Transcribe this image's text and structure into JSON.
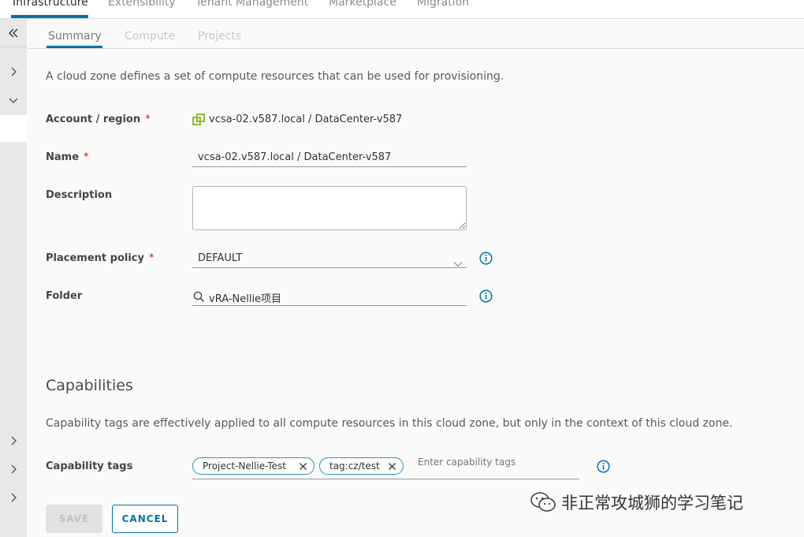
{
  "topnav": {
    "tabs": [
      "Infrastructure",
      "Extensibility",
      "Tenant Management",
      "Marketplace",
      "Migration"
    ],
    "active": "Infrastructure"
  },
  "subtabs": {
    "items": [
      "Summary",
      "Compute",
      "Projects"
    ],
    "active": "Summary"
  },
  "intro": "A cloud zone defines a set of compute resources that can be used for provisioning.",
  "form": {
    "account_region": {
      "label": "Account / region",
      "required_mark": "*",
      "value": "vcsa-02.v587.local / DataCenter-v587"
    },
    "name": {
      "label": "Name",
      "required_mark": "*",
      "value": "vcsa-02.v587.local / DataCenter-v587"
    },
    "description": {
      "label": "Description",
      "value": ""
    },
    "placement_policy": {
      "label": "Placement policy",
      "required_mark": "*",
      "value": "DEFAULT"
    },
    "folder": {
      "label": "Folder",
      "value": "vRA-Nellie项目"
    }
  },
  "capabilities": {
    "title": "Capabilities",
    "description": "Capability tags are effectively applied to all compute resources in this cloud zone, but only in the context of this cloud zone.",
    "tags_label": "Capability tags",
    "tags": [
      "Project-Nellie-Test",
      "tag:cz/test"
    ],
    "placeholder": "Enter capability tags"
  },
  "buttons": {
    "save": "SAVE",
    "cancel": "CANCEL"
  },
  "watermark": "非正常攻城狮的学习笔记",
  "colors": {
    "accent": "#0072a3",
    "required": "#c92100",
    "vsphere_icon": "#8fb93d"
  },
  "icons": {
    "collapse": "double-chevron-left-icon",
    "info": "info-circle-icon",
    "search": "search-icon",
    "dropdown": "chevron-down-icon",
    "remove_tag": "close-icon"
  }
}
